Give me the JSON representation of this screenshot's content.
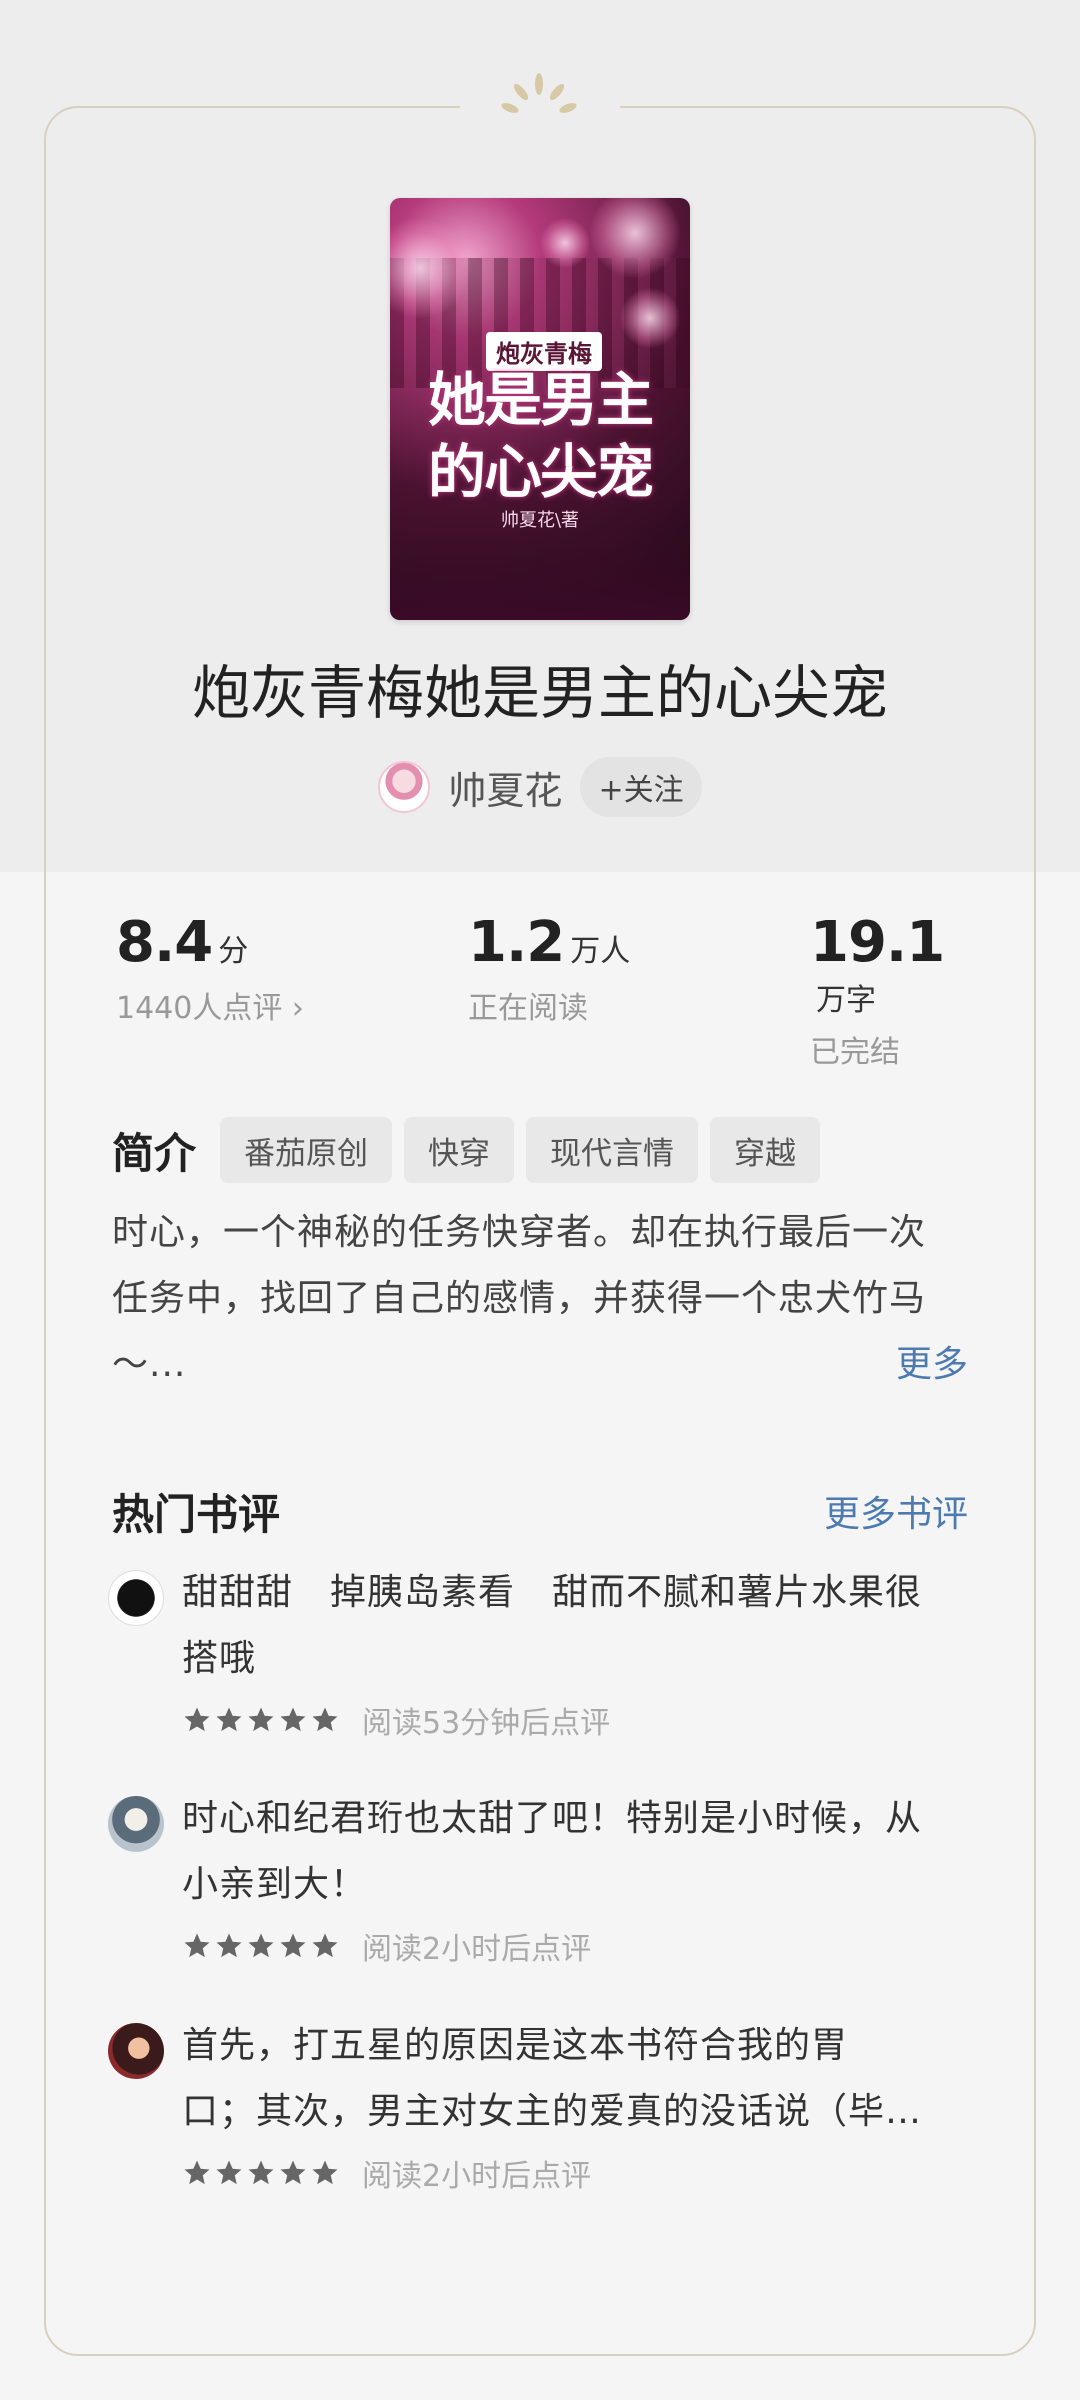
{
  "book": {
    "title": "炮灰青梅她是男主的心尖宠",
    "cover": {
      "tag": "炮灰青梅",
      "title": "她是男主的心尖宠",
      "author": "帅夏花\\著"
    },
    "author": "帅夏花",
    "follow_label": "+关注"
  },
  "stats": {
    "score_value": "8.4",
    "score_unit": "分",
    "score_sub": "1440人点评 ›",
    "readers_value": "1.2",
    "readers_unit": "万人",
    "readers_sub": "正在阅读",
    "words_value": "19.1",
    "words_unit": "万字",
    "words_sub": "已完结"
  },
  "intro": {
    "label": "简介",
    "tags": [
      "番茄原创",
      "快穿",
      "现代言情",
      "穿越"
    ],
    "text_line1": "时心，一个神秘的任务快穿者。却在执行最后一次",
    "text_line2": "任务中，找回了自己的感情，并获得一个忠犬竹马",
    "text_line3": "～...",
    "more_label": "更多"
  },
  "reviews": {
    "title": "热门书评",
    "more_label": "更多书评",
    "items": [
      {
        "line1": "甜甜甜　掉胰岛素看　甜而不腻和薯片水果很",
        "line2": "搭哦",
        "stars": 5,
        "meta": "阅读53分钟后点评"
      },
      {
        "line1": "时心和纪君珩也太甜了吧！特别是小时候，从",
        "line2": "小亲到大！",
        "stars": 5,
        "meta": "阅读2小时后点评"
      },
      {
        "line1": "首先，打五星的原因是这本书符合我的胃",
        "line2": "口；其次，男主对女主的爱真的没话说（毕…",
        "stars": 5,
        "meta": "阅读2小时后点评"
      }
    ]
  },
  "colors": {
    "accent_link": "#4d7bb0",
    "star": "#666666",
    "frame": "#d9cfbd"
  }
}
